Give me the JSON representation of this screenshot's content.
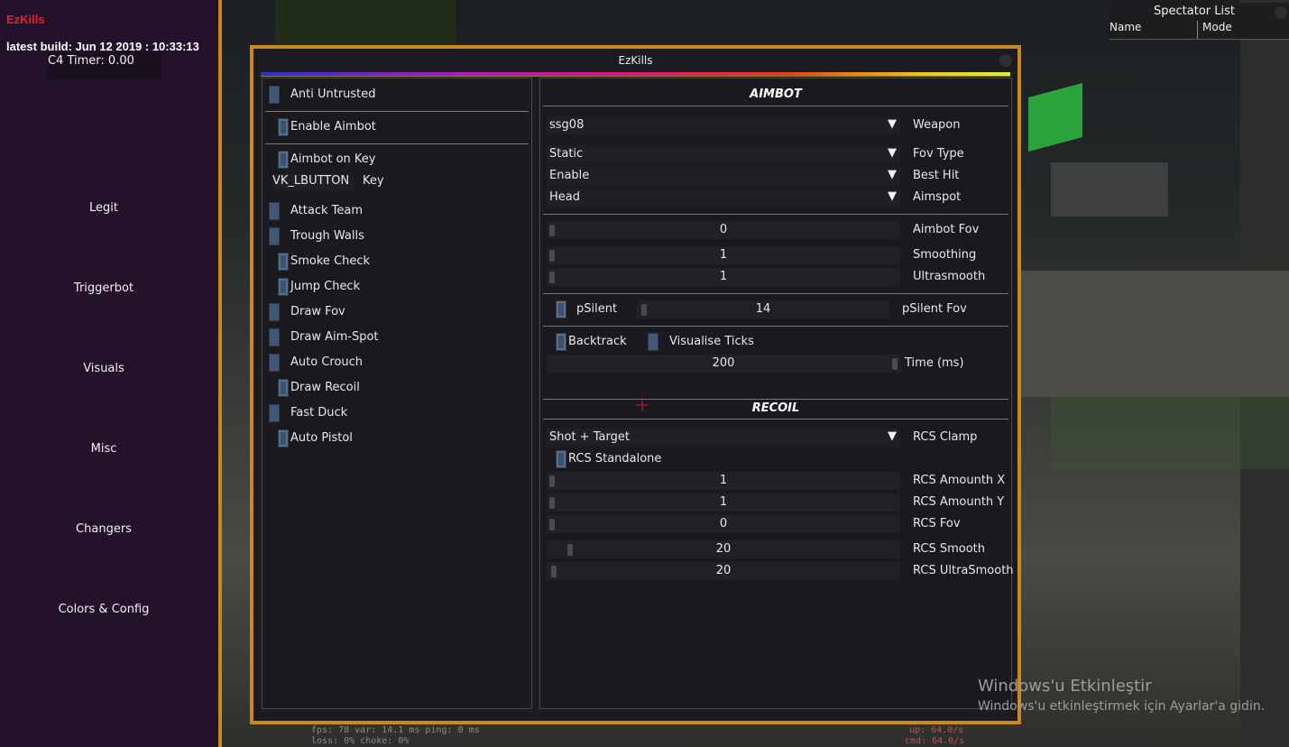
{
  "sidebar": {
    "brand": "EzKills",
    "build": "latest build: Jun 12 2019 : 10:33:13",
    "c4_timer": "C4 Timer: 0.00",
    "items": [
      {
        "label": "Legit"
      },
      {
        "label": "Triggerbot"
      },
      {
        "label": "Visuals"
      },
      {
        "label": "Misc"
      },
      {
        "label": "Changers"
      },
      {
        "label": "Colors & Config"
      }
    ]
  },
  "spectator": {
    "title": "Spectator List",
    "col_name": "Name",
    "col_mode": "Mode"
  },
  "window": {
    "title": "EzKills"
  },
  "left": {
    "anti_untrusted": "Anti Untrusted",
    "enable_aimbot": "Enable Aimbot",
    "aimbot_on_key": "Aimbot on Key",
    "key_value": "VK_LBUTTON",
    "key_label": "Key",
    "attack_team": "Attack Team",
    "trough_walls": "Trough Walls",
    "smoke_check": "Smoke Check",
    "jump_check": "Jump Check",
    "draw_fov": "Draw Fov",
    "draw_aim_spot": "Draw Aim-Spot",
    "auto_crouch": "Auto Crouch",
    "draw_recoil": "Draw Recoil",
    "fast_duck": "Fast Duck",
    "auto_pistol": "Auto Pistol"
  },
  "aimbot": {
    "title": "AIMBOT",
    "weapon": {
      "value": "ssg08",
      "label": "Weapon"
    },
    "fov_type": {
      "value": "Static",
      "label": "Fov Type"
    },
    "best_hit": {
      "value": "Enable",
      "label": "Best Hit"
    },
    "aimspot": {
      "value": "Head",
      "label": "Aimspot"
    },
    "aimbot_fov": {
      "value": "0",
      "label": "Aimbot Fov"
    },
    "smoothing": {
      "value": "1",
      "label": "Smoothing"
    },
    "ultrasmooth": {
      "value": "1",
      "label": "Ultrasmooth"
    },
    "psilent": "pSilent",
    "psilent_fov": {
      "value": "14",
      "label": "pSilent Fov"
    },
    "backtrack": "Backtrack",
    "visualise_ticks": "Visualise Ticks",
    "time": {
      "value": "200",
      "label": "Time (ms)"
    }
  },
  "recoil": {
    "title": "RECOIL",
    "rcs_clamp": {
      "value": "Shot + Target",
      "label": "RCS Clamp"
    },
    "rcs_standalone": "RCS Standalone",
    "amount_x": {
      "value": "1",
      "label": "RCS Amounth X"
    },
    "amount_y": {
      "value": "1",
      "label": "RCS Amounth Y"
    },
    "rcs_fov": {
      "value": "0",
      "label": "RCS Fov"
    },
    "rcs_smooth": {
      "value": "20",
      "label": "RCS Smooth"
    },
    "rcs_ultrasmooth": {
      "value": "20",
      "label": "RCS UltraSmooth"
    }
  },
  "watermark": {
    "line1": "Windows'u Etkinleştir",
    "line2": "Windows'u etkinleştirmek için Ayarlar'a gidin."
  },
  "netgraph": {
    "line1": "fps:    78  var: 14.1 ms  ping: 0 ms",
    "line2": "loss:   0%  choke:  0%",
    "line3": "up: 64.0/s",
    "line4": "cmd: 64.0/s"
  },
  "colors": {
    "accent": "#c8891f",
    "checkbox": "#425876",
    "brand": "#e8232b"
  }
}
